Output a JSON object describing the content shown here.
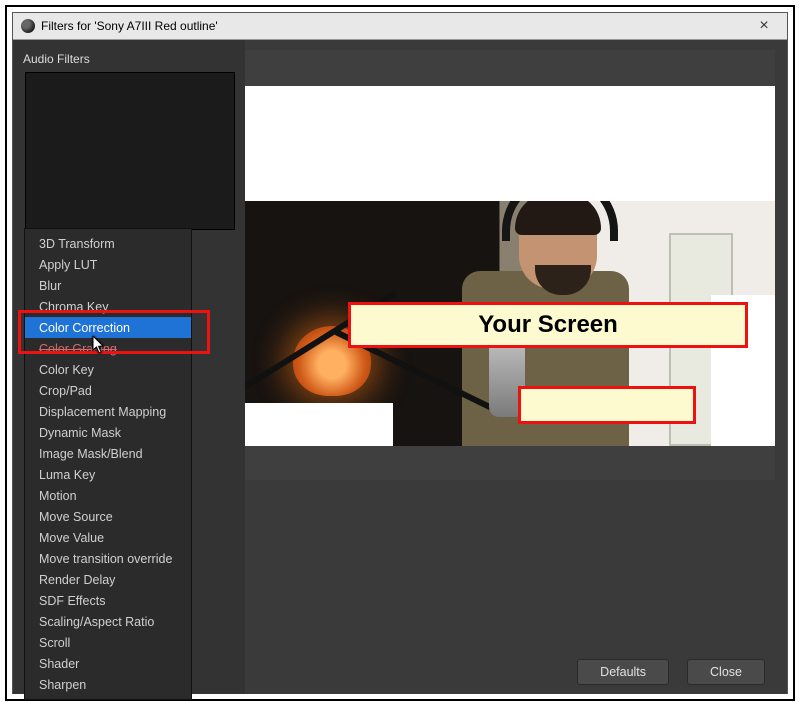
{
  "window": {
    "title": "Filters for 'Sony A7III Red outline'"
  },
  "sidebar": {
    "section_label": "Audio Filters"
  },
  "context_menu": {
    "items": [
      {
        "label": "3D Transform",
        "selected": false,
        "struck": false
      },
      {
        "label": "Apply LUT",
        "selected": false,
        "struck": false
      },
      {
        "label": "Blur",
        "selected": false,
        "struck": false
      },
      {
        "label": "Chroma Key",
        "selected": false,
        "struck": false
      },
      {
        "label": "Color Correction",
        "selected": true,
        "struck": false
      },
      {
        "label": "Color Grading",
        "selected": false,
        "struck": true
      },
      {
        "label": "Color Key",
        "selected": false,
        "struck": false
      },
      {
        "label": "Crop/Pad",
        "selected": false,
        "struck": false
      },
      {
        "label": "Displacement Mapping",
        "selected": false,
        "struck": false
      },
      {
        "label": "Dynamic Mask",
        "selected": false,
        "struck": false
      },
      {
        "label": "Image Mask/Blend",
        "selected": false,
        "struck": false
      },
      {
        "label": "Luma Key",
        "selected": false,
        "struck": false
      },
      {
        "label": "Motion",
        "selected": false,
        "struck": false
      },
      {
        "label": "Move Source",
        "selected": false,
        "struck": false
      },
      {
        "label": "Move Value",
        "selected": false,
        "struck": false
      },
      {
        "label": "Move transition override",
        "selected": false,
        "struck": false
      },
      {
        "label": "Render Delay",
        "selected": false,
        "struck": false
      },
      {
        "label": "SDF Effects",
        "selected": false,
        "struck": false
      },
      {
        "label": "Scaling/Aspect Ratio",
        "selected": false,
        "struck": false
      },
      {
        "label": "Scroll",
        "selected": false,
        "struck": false
      },
      {
        "label": "Shader",
        "selected": false,
        "struck": false
      },
      {
        "label": "Sharpen",
        "selected": false,
        "struck": false
      }
    ]
  },
  "annotations": {
    "big_label": "Your Screen",
    "small_label": ""
  },
  "buttons": {
    "defaults": "Defaults",
    "close": "Close"
  }
}
